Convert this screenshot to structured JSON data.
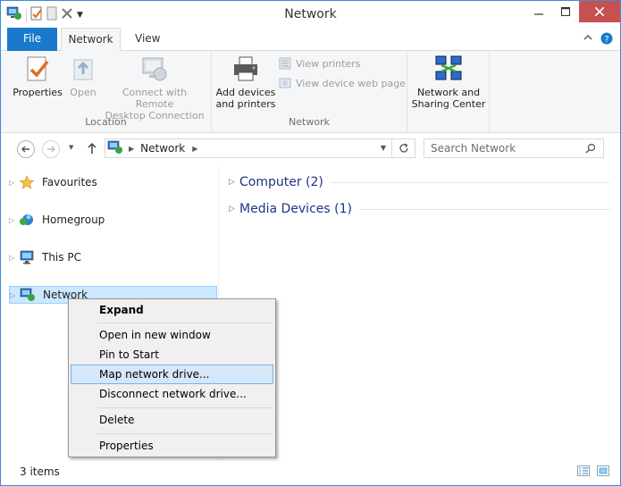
{
  "window": {
    "title": "Network"
  },
  "ribbon": {
    "tabs": [
      {
        "label": "File"
      },
      {
        "label": "Network"
      },
      {
        "label": "View"
      }
    ],
    "groups": {
      "location": {
        "label": "Location",
        "properties": "Properties",
        "open": "Open",
        "connect_line1": "Connect with Remote",
        "connect_line2": "Desktop Connection"
      },
      "network": {
        "label": "Network",
        "add_line1": "Add devices",
        "add_line2": "and printers",
        "view_printers": "View printers",
        "view_device_web_page": "View device web page"
      },
      "sharing": {
        "line1": "Network and",
        "line2": "Sharing Center"
      }
    }
  },
  "address": {
    "crumb": "Network",
    "search_placeholder": "Search Network"
  },
  "nav_pane": {
    "items": [
      {
        "label": "Favourites",
        "icon": "star-icon"
      },
      {
        "label": "Homegroup",
        "icon": "homegroup-icon"
      },
      {
        "label": "This PC",
        "icon": "computer-icon"
      },
      {
        "label": "Network",
        "icon": "network-icon",
        "selected": true
      }
    ]
  },
  "content": {
    "groups": [
      {
        "label": "Computer (2)"
      },
      {
        "label": "Media Devices (1)"
      }
    ]
  },
  "context_menu": {
    "items": [
      {
        "label": "Expand",
        "bold": true
      },
      {
        "label": "Open in new window"
      },
      {
        "label": "Pin to Start"
      },
      {
        "label": "Map network drive...",
        "highlighted": true
      },
      {
        "label": "Disconnect network drive..."
      },
      {
        "label": "Delete"
      },
      {
        "label": "Properties"
      }
    ]
  },
  "status_bar": {
    "count": "3 items"
  },
  "colors": {
    "accent": "#1979ca",
    "selection": "#cce8ff",
    "close": "#c75050",
    "group_text": "#1e3287"
  }
}
